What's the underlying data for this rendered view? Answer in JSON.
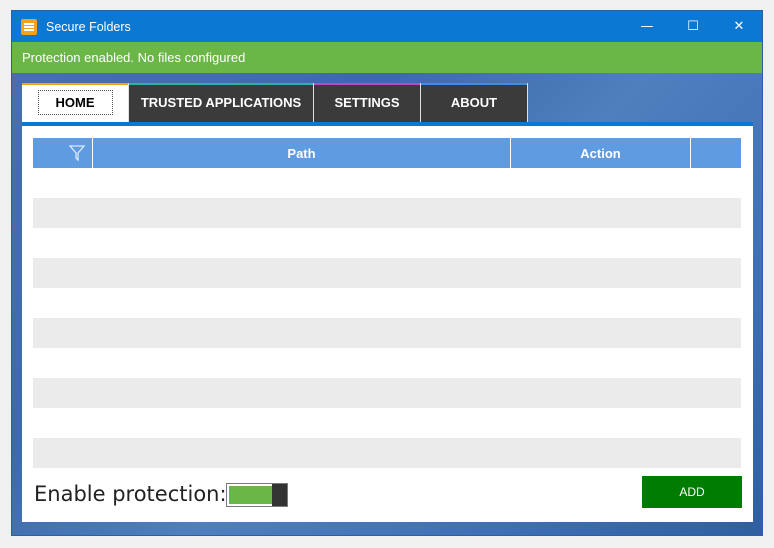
{
  "window": {
    "title": "Secure Folders",
    "controls": {
      "minimize": "—",
      "maximize": "☐",
      "close": "✕"
    }
  },
  "status": {
    "text": "Protection enabled. No files configured",
    "color": "#6ab646"
  },
  "tabs": [
    {
      "label": "HOME",
      "active": true,
      "accent": "#f2a21b"
    },
    {
      "label": "TRUSTED APPLICATIONS",
      "active": false,
      "accent": "#2bb3a8"
    },
    {
      "label": "SETTINGS",
      "active": false,
      "accent": "#b24fb8"
    },
    {
      "label": "ABOUT",
      "active": false,
      "accent": "#3a8ee6"
    }
  ],
  "table": {
    "columns": [
      {
        "key": "filter",
        "label": "",
        "icon": "filter-icon"
      },
      {
        "key": "path",
        "label": "Path"
      },
      {
        "key": "action",
        "label": "Action"
      },
      {
        "key": "extra",
        "label": ""
      }
    ],
    "rows": []
  },
  "protection": {
    "label": "Enable protection:",
    "enabled": true,
    "level": 0.75
  },
  "add_button": {
    "label": "ADD"
  },
  "colors": {
    "accent": "#0b78d4",
    "header": "#5f9be0",
    "add": "#007c00"
  }
}
